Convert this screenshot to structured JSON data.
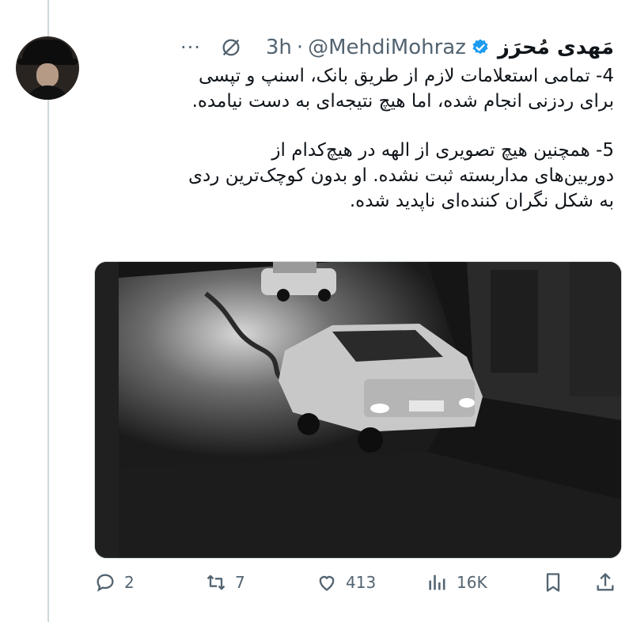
{
  "tweet": {
    "display_name": "مَهدی مُحرَز",
    "handle": "@MehdiMohraz",
    "separator": "·",
    "time": "3h",
    "more": "···",
    "paragraph_1_lines": [
      "4- تمامی استعلامات لازم از طریق بانک، اسنپ و تپسی",
      "برای ردزنی انجام شده، اما هیچ نتیجه‌ای به دست نیامده."
    ],
    "paragraph_2_lines": [
      "5- همچنین هیچ تصویری از الهه در هیچ‌کدام از",
      "دوربین‌های مداربسته ثبت نشده. او بدون کوچک‌ترین ردی",
      "به شکل نگران کننده‌ای ناپدید شده."
    ]
  },
  "stats": {
    "replies": "2",
    "reposts": "7",
    "likes": "413",
    "views": "16K"
  },
  "icons": {
    "verified": "verified-badge-icon",
    "grok": "grok-icon",
    "reply": "reply-icon",
    "repost": "repost-icon",
    "like": "heart-icon",
    "views": "views-icon",
    "bookmark": "bookmark-icon",
    "share": "share-icon"
  },
  "colors": {
    "accent": "#1d9bf0",
    "muted": "#536471",
    "text": "#0f1419"
  }
}
